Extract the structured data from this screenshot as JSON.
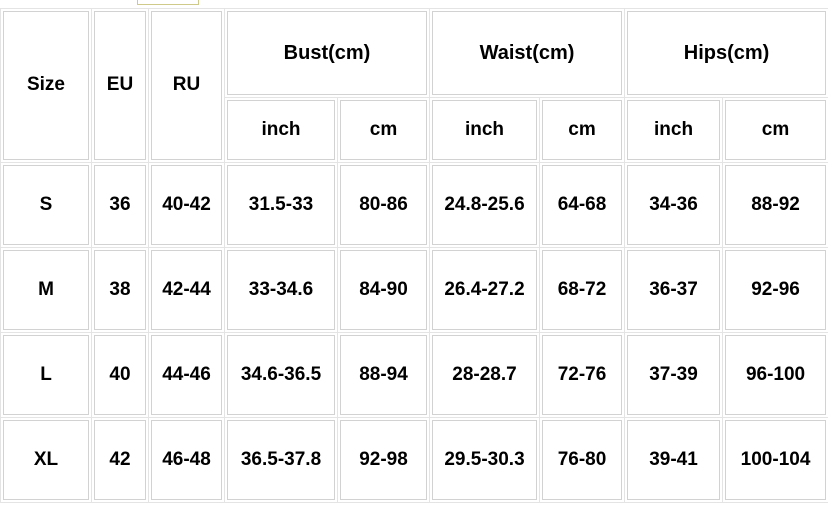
{
  "table": {
    "headers": {
      "size": "Size",
      "eu": "EU",
      "ru": "RU",
      "groups": [
        {
          "label": "Bust(cm)",
          "sub": [
            "inch",
            "cm"
          ]
        },
        {
          "label": "Waist(cm)",
          "sub": [
            "inch",
            "cm"
          ]
        },
        {
          "label": "Hips(cm)",
          "sub": [
            "inch",
            "cm"
          ]
        }
      ]
    },
    "sub_labels": {
      "bust_inch": "inch",
      "bust_cm": "cm",
      "waist_inch": "inch",
      "waist_cm": "cm",
      "hips_inch": "inch",
      "hips_cm": "cm"
    },
    "rows": [
      {
        "size": "S",
        "eu": "36",
        "ru": "40-42",
        "bust_inch": "31.5-33",
        "bust_cm": "80-86",
        "waist_inch": "24.8-25.6",
        "waist_cm": "64-68",
        "hips_inch": "34-36",
        "hips_cm": "88-92"
      },
      {
        "size": "M",
        "eu": "38",
        "ru": "42-44",
        "bust_inch": "33-34.6",
        "bust_cm": "84-90",
        "waist_inch": "26.4-27.2",
        "waist_cm": "68-72",
        "hips_inch": "36-37",
        "hips_cm": "92-96"
      },
      {
        "size": "L",
        "eu": "40",
        "ru": "44-46",
        "bust_inch": "34.6-36.5",
        "bust_cm": "88-94",
        "waist_inch": "28-28.7",
        "waist_cm": "72-76",
        "hips_inch": "37-39",
        "hips_cm": "96-100"
      },
      {
        "size": "XL",
        "eu": "42",
        "ru": "46-48",
        "bust_inch": "36.5-37.8",
        "bust_cm": "92-98",
        "waist_inch": "29.5-30.3",
        "waist_cm": "76-80",
        "hips_inch": "39-41",
        "hips_cm": "100-104"
      }
    ]
  },
  "colors": {
    "border_outer": "#e4e4e4",
    "border_inner": "#d2d2d2",
    "text": "#000000",
    "background": "#ffffff",
    "clipped_box_border": "#cfc98a"
  }
}
